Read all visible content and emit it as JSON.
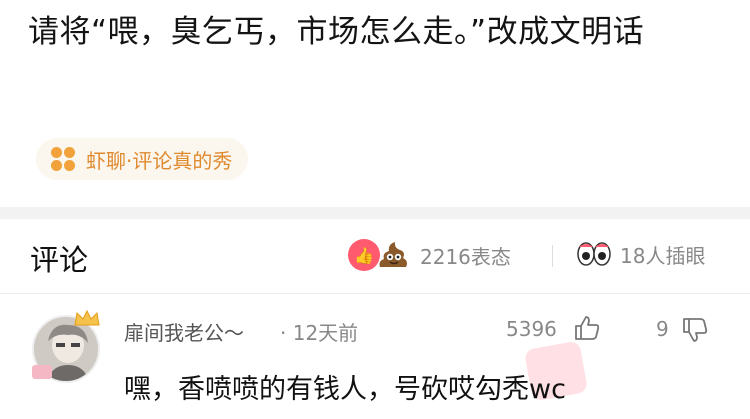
{
  "post": {
    "title": "请将“喂，臭乞丐，市场怎么走。”改成文明话",
    "topic_chip": "虾聊·评论真的秀"
  },
  "comments_header": {
    "label": "评论",
    "reaction_count": "2216表态",
    "watch_count": "18人插眼"
  },
  "comment": {
    "username": "扉间我老公～",
    "time": "· 12天前",
    "like_count": "5396",
    "dislike_count": "9",
    "text": "嘿，香喷喷的有钱人，号砍哎勾秃wc"
  },
  "colors": {
    "accent_orange": "#e08a2e",
    "chip_bg": "#fbf6ee",
    "like_red": "#ff5a6e",
    "separator": "#f2f2f2"
  },
  "icons": [
    "flower-icon",
    "like-reaction-icon",
    "poop-reaction-icon",
    "eyes-icon",
    "crown-icon",
    "thumbs-up-icon",
    "thumbs-down-icon"
  ]
}
